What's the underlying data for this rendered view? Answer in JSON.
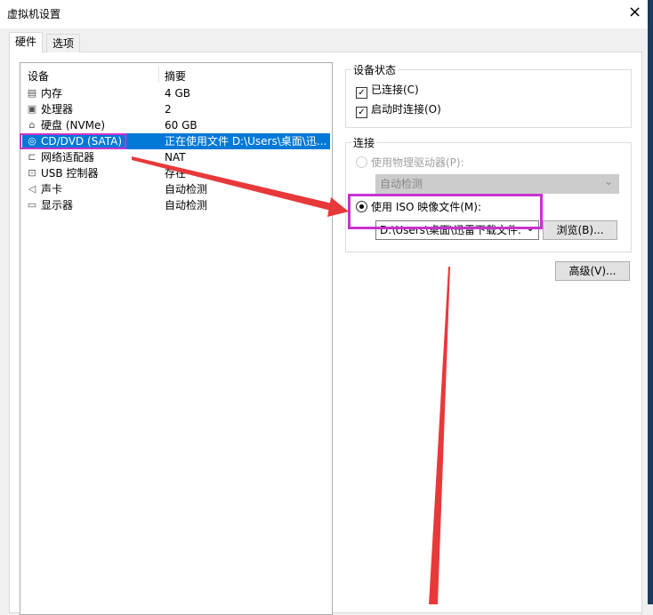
{
  "window": {
    "title": "虚拟机设置",
    "close_icon": "×"
  },
  "tabs": [
    {
      "label": "硬件"
    },
    {
      "label": "选项"
    }
  ],
  "device_list": {
    "headers": {
      "device": "设备",
      "summary": "摘要"
    },
    "rows": [
      {
        "icon": "memory-icon",
        "glyph": "▤",
        "name": "内存",
        "summary": "4 GB"
      },
      {
        "icon": "cpu-icon",
        "glyph": "▣",
        "name": "处理器",
        "summary": "2"
      },
      {
        "icon": "disk-icon",
        "glyph": "⌂",
        "name": "硬盘 (NVMe)",
        "summary": "60 GB"
      },
      {
        "icon": "cd-icon",
        "glyph": "◎",
        "name": "CD/DVD (SATA)",
        "summary": "正在使用文件 D:\\Users\\桌面\\迅...",
        "selected": true
      },
      {
        "icon": "network-icon",
        "glyph": "⊏",
        "name": "网络适配器",
        "summary": "NAT"
      },
      {
        "icon": "usb-icon",
        "glyph": "⊡",
        "name": "USB 控制器",
        "summary": "存在"
      },
      {
        "icon": "sound-icon",
        "glyph": "◁",
        "name": "声卡",
        "summary": "自动检测"
      },
      {
        "icon": "display-icon",
        "glyph": "▭",
        "name": "显示器",
        "summary": "自动检测"
      }
    ]
  },
  "device_status": {
    "label": "设备状态",
    "connected": "已连接(C)",
    "connect_on_start": "启动时连接(O)",
    "check": "✓"
  },
  "connection": {
    "label": "连接",
    "physical": "使用物理驱动器(P):",
    "physical_value": "自动检测",
    "iso": "使用 ISO 映像文件(M):",
    "iso_value": "D:\\Users\\桌面\\迅雷下载文件.",
    "browse": "浏览(B)...",
    "chevron": "⌄"
  },
  "advanced": "高级(V)...",
  "colors": {
    "highlight": "#c832d2",
    "arrow": "#e8393a",
    "selection": "#0078d7"
  }
}
